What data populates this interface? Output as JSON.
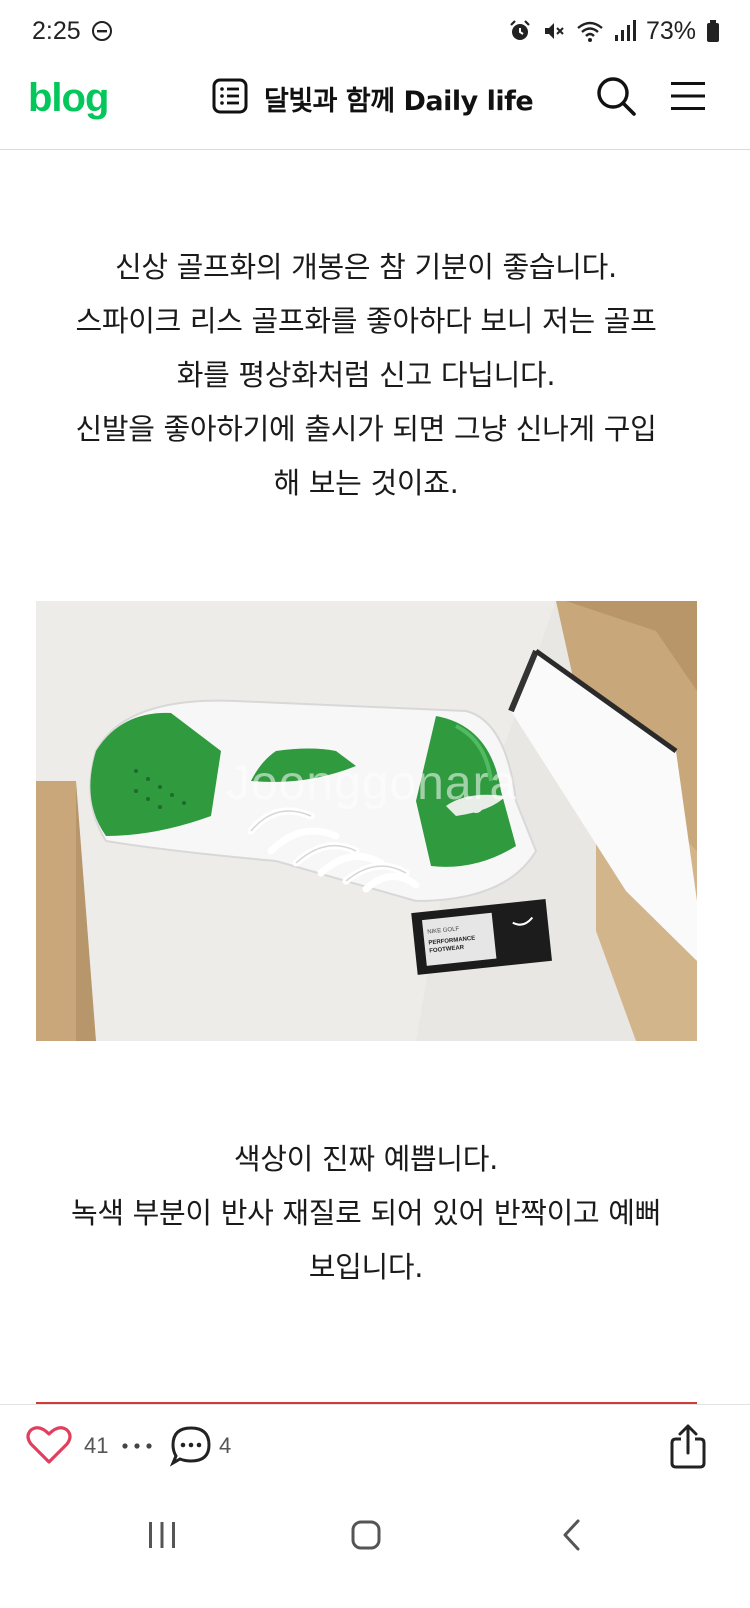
{
  "status_bar": {
    "time": "2:25",
    "battery": "73%",
    "icons": [
      "do-not-disturb-icon",
      "alarm-icon",
      "mute-icon",
      "wifi-icon",
      "signal-icon",
      "battery-icon"
    ]
  },
  "header": {
    "logo": "blog",
    "blog_title": "달빛과 함께 Daily life",
    "icons": [
      "list-icon",
      "search-icon",
      "menu-icon"
    ]
  },
  "post": {
    "paragraph1": [
      "신상 골프화의 개봉은 참 기분이 좋습니다.",
      "스파이크 리스 골프화를 좋아하다 보니 저는 골프",
      "화를 평상화처럼 신고 다닙니다.",
      "신발을 좋아하기에 출시가 되면 그냥 신나게 구입",
      "해 보는 것이죠."
    ],
    "photo": {
      "watermark": "Joonggonara",
      "tag_lines": [
        "NIKE GOLF",
        "PERFORMANCE",
        "FOOTWEAR"
      ]
    },
    "paragraph2": [
      "색상이 진짜 예쁩니다.",
      "녹색 부분이 반사 재질로 되어 있어 반짝이고 예뻐",
      "보입니다."
    ]
  },
  "actions": {
    "like_count": "41",
    "comment_count": "4",
    "icons": [
      "heart-icon",
      "more-icon",
      "comment-icon",
      "share-icon"
    ]
  },
  "nav": {
    "icons": [
      "recent-apps-icon",
      "home-icon",
      "back-icon"
    ]
  },
  "colors": {
    "brand_green": "#03c75a",
    "heart_pink": "#e0405e",
    "shoe_green": "#2f9a3e"
  }
}
